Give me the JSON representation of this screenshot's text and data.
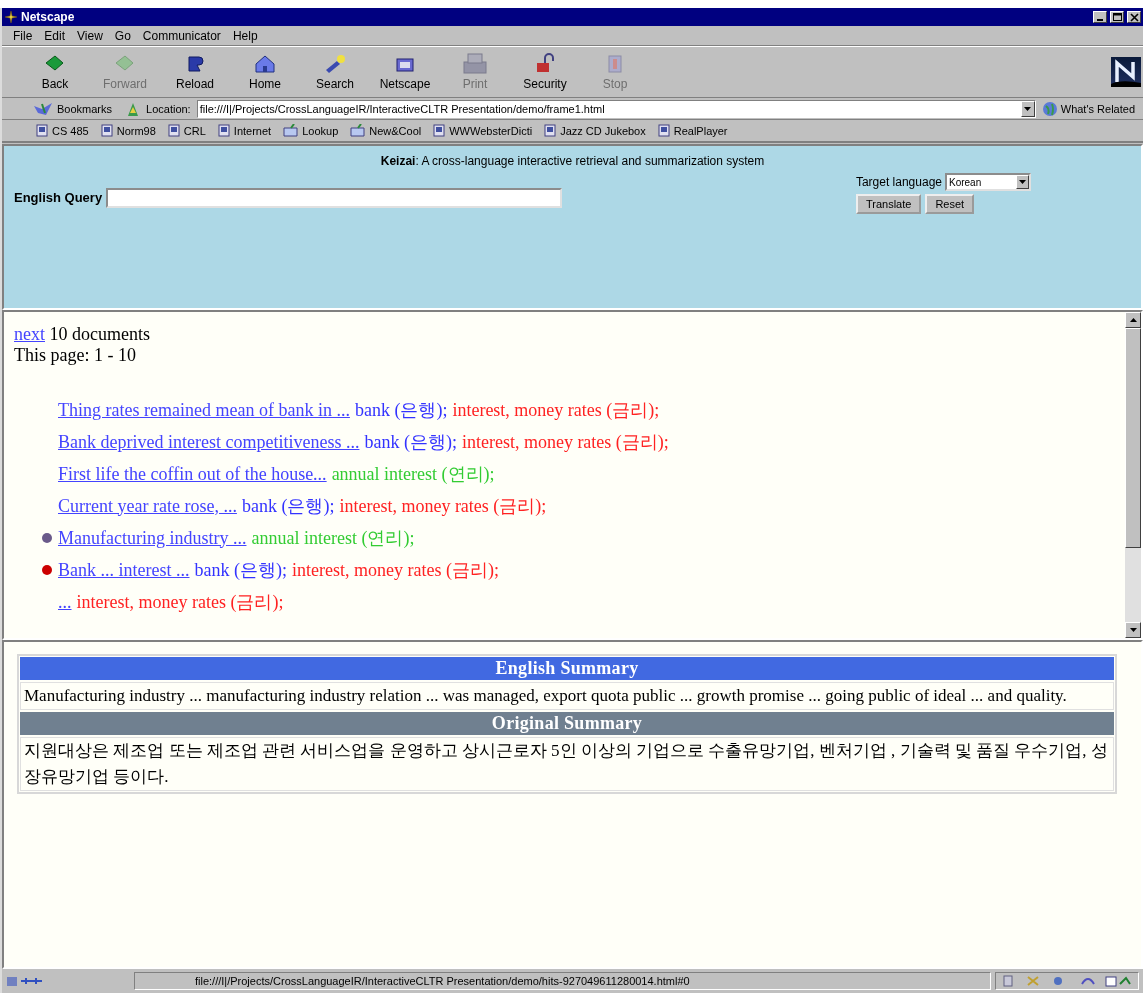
{
  "window": {
    "title": "Netscape"
  },
  "menu": [
    "File",
    "Edit",
    "View",
    "Go",
    "Communicator",
    "Help"
  ],
  "toolbar": [
    {
      "label": "Back",
      "kind": "back",
      "disabled": false
    },
    {
      "label": "Forward",
      "kind": "forward",
      "disabled": true
    },
    {
      "label": "Reload",
      "kind": "reload",
      "disabled": false
    },
    {
      "label": "Home",
      "kind": "home",
      "disabled": false
    },
    {
      "label": "Search",
      "kind": "search",
      "disabled": false
    },
    {
      "label": "Netscape",
      "kind": "netscape",
      "disabled": false
    },
    {
      "label": "Print",
      "kind": "print",
      "disabled": true
    },
    {
      "label": "Security",
      "kind": "security",
      "disabled": false
    },
    {
      "label": "Stop",
      "kind": "stop",
      "disabled": true
    }
  ],
  "location_bar": {
    "bookmarks": "Bookmarks",
    "label": "Location:",
    "value": "file:///I|/Projects/CrossLanguageIR/InteractiveCLTR Presentation/demo/frame1.html",
    "related": "What's Related"
  },
  "personal_toolbar": [
    {
      "label": "CS 485",
      "kind": "page"
    },
    {
      "label": "Norm98",
      "kind": "page"
    },
    {
      "label": "CRL",
      "kind": "page"
    },
    {
      "label": "Internet",
      "kind": "page"
    },
    {
      "label": "Lookup",
      "kind": "folder"
    },
    {
      "label": "New&Cool",
      "kind": "folder"
    },
    {
      "label": "WWWebsterDicti",
      "kind": "page"
    },
    {
      "label": "Jazz CD Jukebox",
      "kind": "page"
    },
    {
      "label": "RealPlayer",
      "kind": "page"
    }
  ],
  "query_frame": {
    "title": "**Keizai**: A cross-language interactive retrieval and summarization system",
    "query_label": "English Query",
    "target_label": "Target language",
    "target_value": "Korean",
    "buttons": [
      "Translate",
      "Reset"
    ]
  },
  "results": {
    "next_link": "next",
    "next_text": "10 documents",
    "page_info": "This page: 1 - 10",
    "items": [
      {
        "title": "Thing rates remained mean of bank in ...",
        "terms": [
          {
            "text": "bank (은행);",
            "color": "#3333ff"
          },
          {
            "text": "interest, money rates (금리);",
            "color": "#ff2222"
          }
        ]
      },
      {
        "title": "Bank deprived interest competitiveness ...",
        "terms": [
          {
            "text": "bank (은행);",
            "color": "#3333ff"
          },
          {
            "text": "interest, money rates (금리);",
            "color": "#ff2222"
          }
        ]
      },
      {
        "title": "First life the coffin out of the house...",
        "terms": [
          {
            "text": "annual interest (연리);",
            "color": "#33cc33"
          }
        ]
      },
      {
        "title": "Current year rate rose, ...",
        "terms": [
          {
            "text": "bank (은행);",
            "color": "#3333ff"
          },
          {
            "text": "interest, money rates (금리);",
            "color": "#ff2222"
          }
        ]
      },
      {
        "title": "Manufacturing industry ...",
        "bullet": {
          "color": "#6a5a8a"
        },
        "terms": [
          {
            "text": "annual interest (연리);",
            "color": "#33cc33"
          }
        ]
      },
      {
        "title": "Bank ... interest ...",
        "bullet": {
          "color": "#cc0000"
        },
        "terms": [
          {
            "text": "bank (은행);",
            "color": "#3333ff"
          },
          {
            "text": "interest, money rates (금리);",
            "color": "#ff2222"
          }
        ]
      },
      {
        "title": "...",
        "terms": [
          {
            "text": "interest, money rates (금리);",
            "color": "#ff2222"
          }
        ]
      }
    ]
  },
  "summaries": [
    {
      "heading": "English Summary",
      "color": "#4169e1",
      "text": "Manufacturing industry ... manufacturing industry relation ... was managed, export quota public ... growth promise ... going public of ideal ... and quality."
    },
    {
      "heading": "Original Summary",
      "color": "#708090",
      "text": "지원대상은 제조업 또는 제조업 관련 서비스업을 운영하고 상시근로자 5인 이상의 기업으로 수출유망기업, 벤처기업 , 기술력 및 품질 우수기업, 성장유망기업 등이다."
    }
  ],
  "status_bar": {
    "text": "file:///I|/Projects/CrossLanguageIR/InteractiveCLTR Presentation/demo/hits-927049611280014.html#0"
  }
}
